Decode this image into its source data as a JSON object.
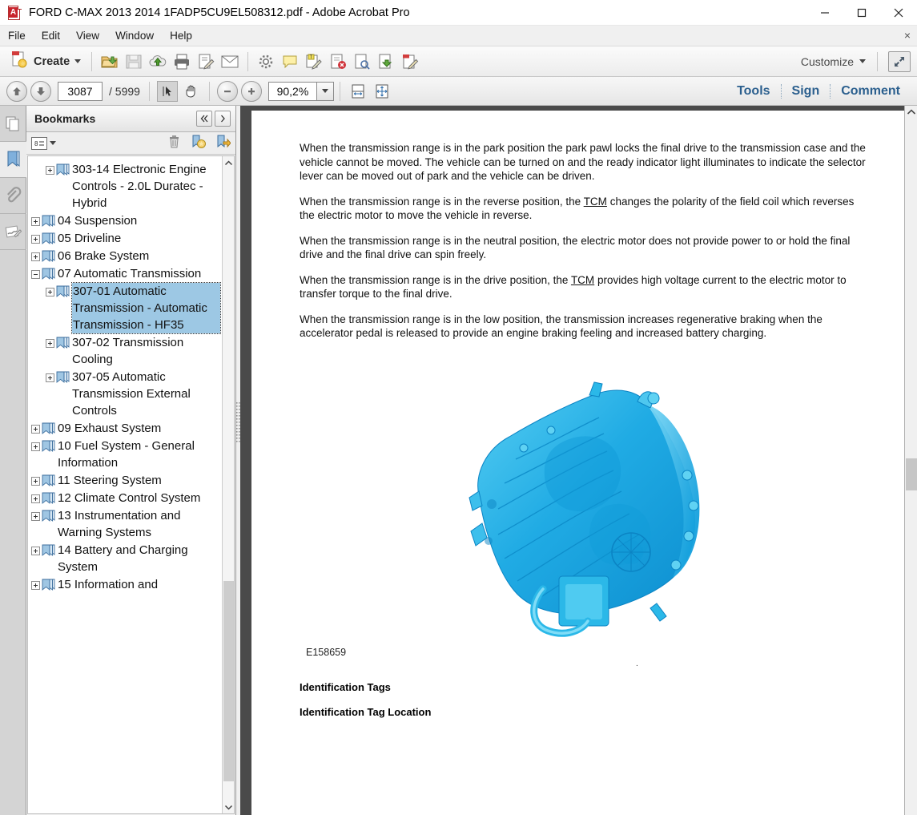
{
  "window": {
    "title": "FORD C-MAX 2013 2014 1FADP5CU9EL508312.pdf - Adobe Acrobat Pro",
    "app_icon": "acrobat-pdf-icon",
    "minimize": "minimize-icon",
    "maximize": "maximize-icon",
    "close": "close-icon"
  },
  "menubar": {
    "items": [
      {
        "label": "File"
      },
      {
        "label": "Edit"
      },
      {
        "label": "View"
      },
      {
        "label": "Window"
      },
      {
        "label": "Help"
      }
    ],
    "close_doc": "×"
  },
  "toolbar": {
    "create_label": "Create",
    "icons": [
      {
        "name": "open-file-icon"
      },
      {
        "name": "save-icon"
      },
      {
        "name": "upload-cloud-icon"
      },
      {
        "name": "print-icon"
      },
      {
        "name": "sign-document-icon"
      },
      {
        "name": "email-icon"
      },
      {
        "name": "settings-gear-icon"
      },
      {
        "name": "comment-bubble-icon"
      },
      {
        "name": "edit-text-icon"
      },
      {
        "name": "delete-page-icon"
      },
      {
        "name": "search-page-icon"
      },
      {
        "name": "export-pdf-icon"
      },
      {
        "name": "edit-pdf-icon"
      }
    ],
    "customize_label": "Customize",
    "expand_icon": "expand-arrows-icon"
  },
  "navbar": {
    "prev_page_icon": "arrow-up-icon",
    "next_page_icon": "arrow-down-icon",
    "current_page": "3087",
    "page_total": "/ 5999",
    "select_tool_icon": "select-cursor-icon",
    "hand_tool_icon": "hand-icon",
    "zoom_out_icon": "zoom-out-icon",
    "zoom_in_icon": "zoom-in-icon",
    "zoom_level": "90,2%",
    "zoom_dropdown_icon": "chevron-down-icon",
    "fit_width_icon": "fit-width-icon",
    "fit_page_icon": "fit-page-icon"
  },
  "right_tabs": [
    {
      "label": "Tools"
    },
    {
      "label": "Sign"
    },
    {
      "label": "Comment"
    }
  ],
  "rail": {
    "items": [
      {
        "name": "page-thumbnails-icon",
        "selected": false
      },
      {
        "name": "bookmarks-icon",
        "selected": true
      },
      {
        "name": "attachments-paperclip-icon",
        "selected": false
      },
      {
        "name": "signatures-icon",
        "selected": false
      }
    ]
  },
  "bookmarks_panel": {
    "title": "Bookmarks",
    "collapse_icon": "double-chevron-left-icon",
    "expand_icon": "chevron-right-icon",
    "options_icon": "options-list-icon",
    "options_dropdown_icon": "chevron-down-icon",
    "delete_icon": "trash-icon",
    "new_bookmark_icon": "new-bookmark-icon",
    "new_bookmark_from_structure_icon": "bookmark-from-structure-icon",
    "scroll_up_icon": "chevron-up-icon",
    "scroll_down_icon": "chevron-down-icon",
    "items": [
      {
        "label": "303-14 Electronic Engine Controls - 2.0L Duratec - Hybrid",
        "expander": "plus",
        "indent": 1,
        "selected": false
      },
      {
        "label": "04 Suspension",
        "expander": "plus",
        "indent": 0,
        "selected": false
      },
      {
        "label": "05 Driveline",
        "expander": "plus",
        "indent": 0,
        "selected": false
      },
      {
        "label": "06 Brake System",
        "expander": "plus",
        "indent": 0,
        "selected": false
      },
      {
        "label": "07 Automatic Transmission",
        "expander": "minus",
        "indent": 0,
        "selected": false
      },
      {
        "label": "307-01 Automatic Transmission - Automatic Transmission - HF35",
        "expander": "plus",
        "indent": 1,
        "selected": true
      },
      {
        "label": "307-02 Transmission Cooling",
        "expander": "plus",
        "indent": 1,
        "selected": false
      },
      {
        "label": "307-05 Automatic Transmission External Controls",
        "expander": "plus",
        "indent": 1,
        "selected": false
      },
      {
        "label": "09 Exhaust System",
        "expander": "plus",
        "indent": 0,
        "selected": false
      },
      {
        "label": "10 Fuel System - General Information",
        "expander": "plus",
        "indent": 0,
        "selected": false
      },
      {
        "label": "11 Steering System",
        "expander": "plus",
        "indent": 0,
        "selected": false
      },
      {
        "label": "12 Climate Control System",
        "expander": "plus",
        "indent": 0,
        "selected": false
      },
      {
        "label": "13 Instrumentation and Warning Systems",
        "expander": "plus",
        "indent": 0,
        "selected": false
      },
      {
        "label": "14 Battery and Charging System",
        "expander": "plus",
        "indent": 0,
        "selected": false
      },
      {
        "label": "15 Information and",
        "expander": "plus",
        "indent": 0,
        "selected": false
      }
    ]
  },
  "document": {
    "paragraphs": [
      {
        "before": "When the transmission range is in the park position the park pawl locks the final drive to the transmission case and the vehicle cannot be moved. The vehicle can be turned on and the ready indicator light illuminates to indicate the selector lever can be moved out of park and the vehicle can be driven.",
        "link": "",
        "after": ""
      },
      {
        "before": "When the transmission range is in the reverse position, the ",
        "link": "TCM",
        "after": " changes the polarity of the field coil which reverses the electric motor to move the vehicle in reverse."
      },
      {
        "before": "When the transmission range is in the neutral position, the electric motor does not provide power to or hold the final drive and the final drive can spin freely.",
        "link": "",
        "after": ""
      },
      {
        "before": "When the transmission range is in the drive position, the ",
        "link": "TCM",
        "after": " provides high voltage current to the electric motor to transfer torque to the final drive."
      },
      {
        "before": "When the transmission range is in the low position, the transmission increases regenerative braking when the accelerator pedal is released to provide an engine braking feeling and increased battery charging.",
        "link": "",
        "after": ""
      }
    ],
    "figure": {
      "name": "automatic-transmission-diagram",
      "caption": "E158659",
      "color_main": "#29b6ec",
      "color_dark": "#0f8fd0",
      "color_light": "#6fd4f5"
    },
    "headings": [
      {
        "label": "Identification Tags"
      },
      {
        "label": "Identification Tag Location"
      }
    ],
    "scroll_up_icon": "chevron-up-icon"
  }
}
